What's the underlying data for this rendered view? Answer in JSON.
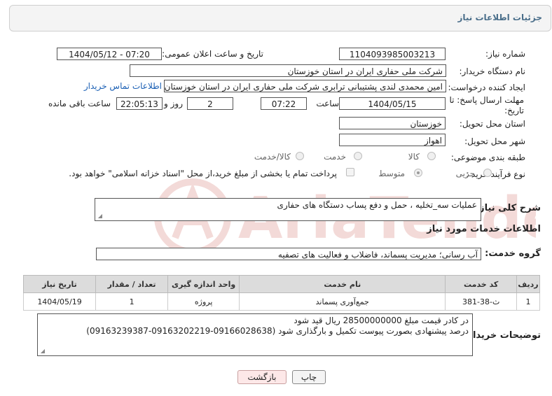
{
  "header": {
    "title": "جزئیات اطلاعات نیاز"
  },
  "labels": {
    "need_number": "شماره نیاز:",
    "announce_datetime": "تاریخ و ساعت اعلان عمومی:",
    "buyer_org": "نام دستگاه خریدار:",
    "requester": "ایجاد کننده درخواست:",
    "reply_deadline": "مهلت ارسال پاسخ: تا تاریخ:",
    "time": "ساعت",
    "day_and": "روز و",
    "remaining": "ساعت باقی مانده",
    "delivery_province": "استان محل تحویل:",
    "delivery_city": "شهر محل تحویل:",
    "category": "طبقه بندی موضوعی:",
    "process_type": "نوع فرآیند خرید :",
    "need_description": "شرح کلی نیاز:",
    "services_header": "اطلاعات خدمات مورد نیاز",
    "service_group": "گروه خدمت:",
    "buyer_notes": "توضیحات خریدار:"
  },
  "fields": {
    "need_number": "1104093985003213",
    "announce_datetime": "1404/05/12 - 07:20",
    "buyer_org": "شرکت ملی حفاری ایران در استان خوزستان",
    "requester": "امین محمدی لندی پشتیبانی ترابری شرکت ملی حفاری ایران در استان خوزستان",
    "contact_link": "اطلاعات تماس خریدار",
    "deadline_date": "1404/05/15",
    "deadline_time": "07:22",
    "days_remaining": "2",
    "time_remaining": "22:05:13",
    "province": "خوزستان",
    "city": "اهواز",
    "need_description": "عملیات سه_تخلیه ، حمل و دفع پساب دستگاه های حفاری",
    "service_group": "آب رسانی؛ مدیریت پسماند، فاضلاب و فعالیت های تصفیه",
    "buyer_notes_line1": "در کادر قیمت مبلغ 28500000000 ریال قید شود",
    "buyer_notes_line2": "درصد پیشنهادی بصورت پیوست تکمیل و بارگذاری شود (09166028638-09163202219-09163239387)"
  },
  "category_options": [
    {
      "label": "کالا",
      "selected": false
    },
    {
      "label": "خدمت",
      "selected": false
    },
    {
      "label": "کالا/خدمت",
      "selected": false
    }
  ],
  "process_options": [
    {
      "label": "جزیی",
      "selected": false
    },
    {
      "label": "متوسط",
      "selected": true
    }
  ],
  "payment_checkbox": {
    "label": "پرداخت تمام یا بخشی از مبلغ خرید،از محل \"اسناد خزانه اسلامی\" خواهد بود.",
    "checked": false
  },
  "table": {
    "headers": [
      "ردیف",
      "کد خدمت",
      "نام خدمت",
      "واحد اندازه گیری",
      "تعداد / مقدار",
      "تاریخ نیاز"
    ],
    "rows": [
      [
        "1",
        "ث-38-381",
        "جمع‌آوری پسماند",
        "پروژه",
        "1",
        "1404/05/19"
      ]
    ]
  },
  "buttons": {
    "print": "چاپ",
    "back": "بازگشت"
  },
  "watermark": {
    "text": "AriaTender.neT"
  },
  "colors": {
    "header_text": "#4a6e8a",
    "link": "#1a5fb4",
    "back_button_bg": "#fde8e8",
    "watermark": "#c0392b"
  }
}
